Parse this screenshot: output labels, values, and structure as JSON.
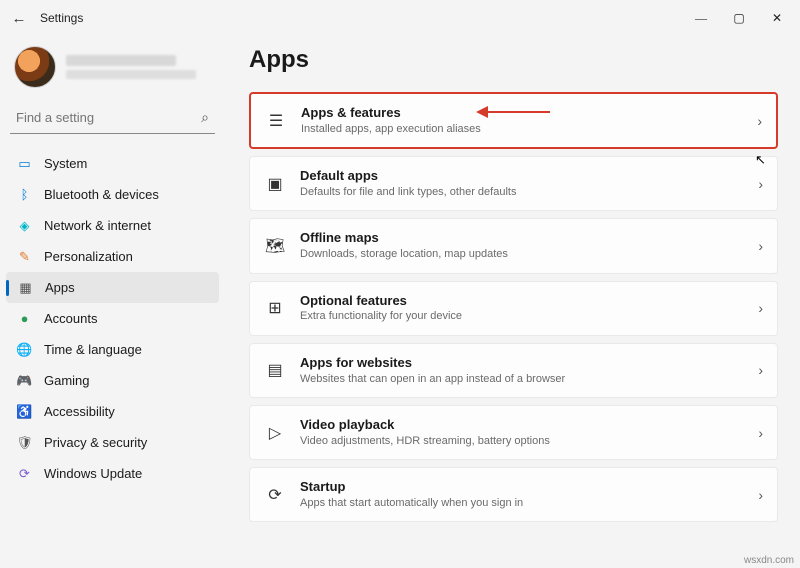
{
  "window": {
    "title": "Settings"
  },
  "search": {
    "placeholder": "Find a setting"
  },
  "nav": {
    "items": [
      {
        "label": "System"
      },
      {
        "label": "Bluetooth & devices"
      },
      {
        "label": "Network & internet"
      },
      {
        "label": "Personalization"
      },
      {
        "label": "Apps"
      },
      {
        "label": "Accounts"
      },
      {
        "label": "Time & language"
      },
      {
        "label": "Gaming"
      },
      {
        "label": "Accessibility"
      },
      {
        "label": "Privacy & security"
      },
      {
        "label": "Windows Update"
      }
    ]
  },
  "page": {
    "title": "Apps"
  },
  "cards": [
    {
      "title": "Apps & features",
      "desc": "Installed apps, app execution aliases"
    },
    {
      "title": "Default apps",
      "desc": "Defaults for file and link types, other defaults"
    },
    {
      "title": "Offline maps",
      "desc": "Downloads, storage location, map updates"
    },
    {
      "title": "Optional features",
      "desc": "Extra functionality for your device"
    },
    {
      "title": "Apps for websites",
      "desc": "Websites that can open in an app instead of a browser"
    },
    {
      "title": "Video playback",
      "desc": "Video adjustments, HDR streaming, battery options"
    },
    {
      "title": "Startup",
      "desc": "Apps that start automatically when you sign in"
    }
  ],
  "attribution": "wsxdn.com"
}
